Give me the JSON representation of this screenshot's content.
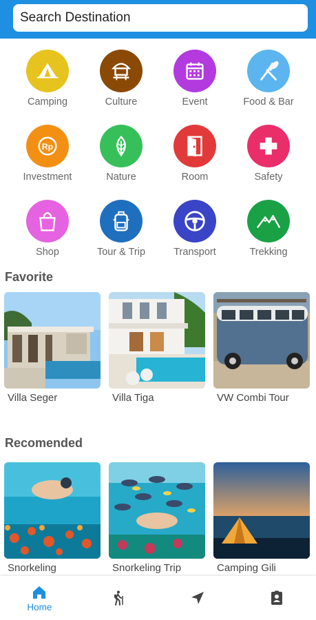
{
  "search": {
    "placeholder": "Search Destination"
  },
  "categories": [
    {
      "label": "Camping",
      "icon": "tent-icon",
      "color": "#e6c31e"
    },
    {
      "label": "Culture",
      "icon": "hut-icon",
      "color": "#8a4a06"
    },
    {
      "label": "Event",
      "icon": "calendar-icon",
      "color": "#b33adf"
    },
    {
      "label": "Food & Bar",
      "icon": "utensils-icon",
      "color": "#5cb5ee"
    },
    {
      "label": "Investment",
      "icon": "rupiah-icon",
      "color": "#f39014"
    },
    {
      "label": "Nature",
      "icon": "leaf-icon",
      "color": "#37c05a"
    },
    {
      "label": "Room",
      "icon": "door-icon",
      "color": "#e23a3a"
    },
    {
      "label": "Safety",
      "icon": "cross-icon",
      "color": "#ea2e6a"
    },
    {
      "label": "Shop",
      "icon": "shopping-bag-icon",
      "color": "#e563e0"
    },
    {
      "label": "Tour & Trip",
      "icon": "backpack-icon",
      "color": "#1f6fbf"
    },
    {
      "label": "Transport",
      "icon": "steering-wheel-icon",
      "color": "#3a44c6"
    },
    {
      "label": "Trekking",
      "icon": "mountain-icon",
      "color": "#1aa146"
    }
  ],
  "favorite": {
    "title": "Favorite",
    "items": [
      {
        "label": "Villa Seger"
      },
      {
        "label": "Villa Tiga"
      },
      {
        "label": "VW Combi Tour"
      }
    ]
  },
  "recommended": {
    "title": "Recomended",
    "items": [
      {
        "label": "Snorkeling"
      },
      {
        "label": "Snorkeling Trip"
      },
      {
        "label": "Camping Gili"
      }
    ]
  },
  "nav": [
    {
      "label": "Home",
      "icon": "home-icon",
      "active": true
    },
    {
      "label": "",
      "icon": "hiker-icon"
    },
    {
      "label": "",
      "icon": "navigation-arrow-icon"
    },
    {
      "label": "",
      "icon": "contact-card-icon"
    }
  ],
  "colors": {
    "primary": "#1e8fe1"
  }
}
